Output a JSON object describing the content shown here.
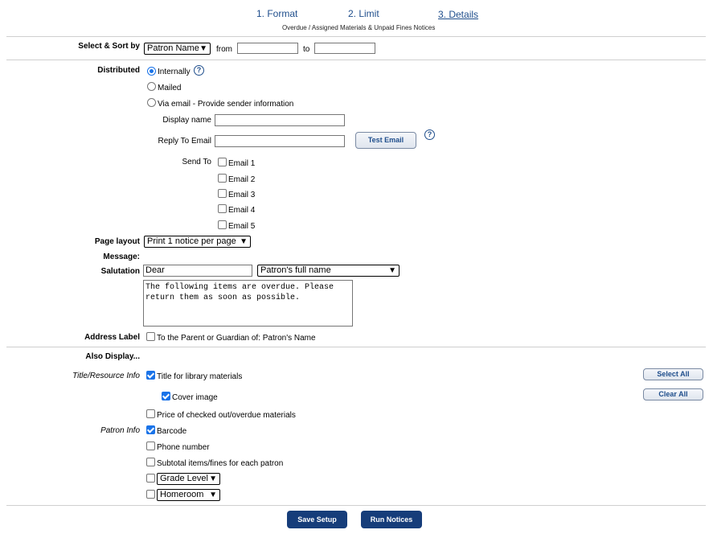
{
  "steps": [
    {
      "label": "1. Format"
    },
    {
      "label": "2. Limit"
    },
    {
      "label": "3. Details"
    }
  ],
  "subtitle": "Overdue / Assigned Materials & Unpaid Fines Notices",
  "sort": {
    "label": "Select & Sort by",
    "selected": "Patron Name",
    "from_label": "from",
    "to_label": "to",
    "from_value": "",
    "to_value": ""
  },
  "distributed": {
    "label": "Distributed",
    "options": [
      "Internally",
      "Mailed",
      "Via email - Provide sender information"
    ],
    "selected": "Internally",
    "display_name_label": "Display name",
    "reply_to_label": "Reply To Email",
    "test_email_label": "Test Email",
    "send_to_label": "Send To",
    "emails": [
      "Email 1",
      "Email 2",
      "Email 3",
      "Email 4",
      "Email 5"
    ]
  },
  "page_layout": {
    "label": "Page layout",
    "selected": "Print 1 notice per page"
  },
  "message_label": "Message:",
  "salutation": {
    "label": "Salutation",
    "value": "Dear",
    "selected": "Patron's full name",
    "message_text": "The following items are overdue. Please return them as soon as possible."
  },
  "address_label": {
    "label": "Address Label",
    "option": "To the Parent or Guardian of: Patron's Name"
  },
  "also_display_label": "Also Display...",
  "title_info": {
    "label": "Title/Resource Info",
    "items": [
      {
        "label": "Title for library materials",
        "checked": true
      },
      {
        "label": "Cover image",
        "checked": true
      },
      {
        "label": "Price of checked out/overdue materials",
        "checked": false
      }
    ]
  },
  "patron_info": {
    "label": "Patron Info",
    "items": [
      {
        "label": "Barcode",
        "checked": true
      },
      {
        "label": "Phone number",
        "checked": false
      },
      {
        "label": "Subtotal items/fines for each patron",
        "checked": false
      }
    ],
    "extra_selects": [
      "Grade Level",
      "Homeroom"
    ]
  },
  "select_all_label": "Select All",
  "clear_all_label": "Clear All",
  "save_setup_label": "Save Setup",
  "run_notices_label": "Run Notices",
  "colors": {
    "link": "#1f4e8c",
    "primary_button": "#163d7a",
    "checkbox": "#1a73e8"
  }
}
